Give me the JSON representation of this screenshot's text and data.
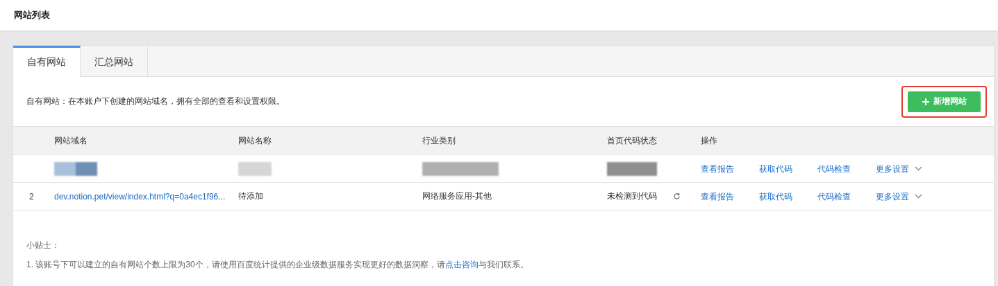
{
  "page_title": "网站列表",
  "tabs": [
    {
      "label": "自有网站",
      "selected": true
    },
    {
      "label": "汇总网站",
      "selected": false
    }
  ],
  "description": "自有网站：在本账户下创建的网站域名，拥有全部的查看和设置权限。",
  "add_button": {
    "label": "新增网站",
    "highlighted": true
  },
  "table": {
    "columns": [
      "网站域名",
      "网站名称",
      "行业类别",
      "首页代码状态",
      "操作"
    ],
    "rows": [
      {
        "kind": "redacted",
        "actions": [
          "查看报告",
          "获取代码",
          "代码检查",
          "更多设置"
        ]
      },
      {
        "kind": "normal",
        "index": "2",
        "domain": "dev.notion.pet/view/index.html?q=0a4ec1f96...",
        "name": "待添加",
        "industry": "网络服务应用-其他",
        "status": "未检测到代码",
        "actions": [
          "查看报告",
          "获取代码",
          "代码检查",
          "更多设置"
        ]
      }
    ]
  },
  "tips": {
    "title": "小贴士：",
    "items": [
      {
        "before": "1. 该账号下可以建立的自有网站个数上限为30个，请使用百度统计提供的企业级数据服务实现更好的数据洞察，请",
        "link": "点击咨询",
        "after": "与我们联系。"
      }
    ]
  }
}
